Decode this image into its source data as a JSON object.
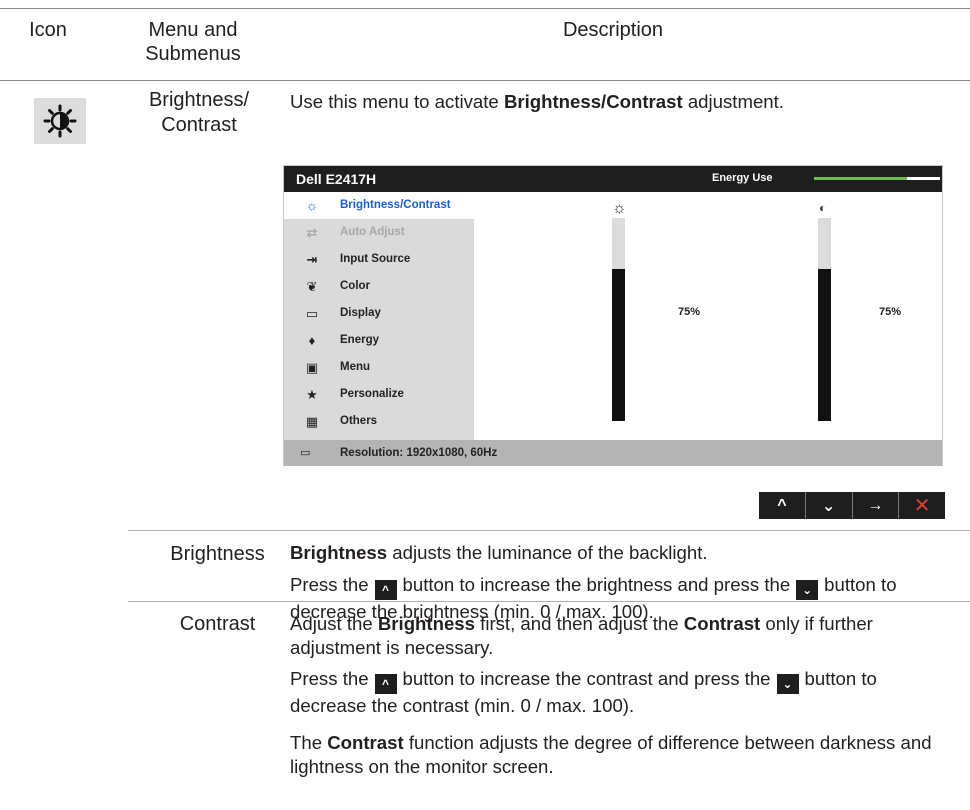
{
  "header": {
    "icon_col": "Icon",
    "menu_col_line1": "Menu and",
    "menu_col_line2": "Submenus",
    "desc_col": "Description"
  },
  "row_brightness_contrast": {
    "icon": "brightness-contrast-icon",
    "label_line1": "Brightness/",
    "label_line2": "Contrast",
    "desc_prefix": "Use this menu to activate ",
    "desc_bold": "Brightness/Contrast",
    "desc_suffix": " adjustment."
  },
  "osd": {
    "title": "Dell E2417H",
    "energy_label": "Energy Use",
    "energy_level": 0.74,
    "menu_items": [
      {
        "icon": "brightness-icon",
        "glyph": "☼",
        "label": "Brightness/Contrast",
        "state": "active"
      },
      {
        "icon": "auto-adjust-icon",
        "glyph": "⇄",
        "label": "Auto Adjust",
        "state": "dim"
      },
      {
        "icon": "input-source-icon",
        "glyph": "⇥",
        "label": "Input Source",
        "state": "normal"
      },
      {
        "icon": "color-icon",
        "glyph": "❦",
        "label": "Color",
        "state": "normal"
      },
      {
        "icon": "display-icon",
        "glyph": "▭",
        "label": "Display",
        "state": "normal"
      },
      {
        "icon": "energy-icon",
        "glyph": "♦",
        "label": "Energy",
        "state": "normal"
      },
      {
        "icon": "menu-icon",
        "glyph": "▣",
        "label": "Menu",
        "state": "normal"
      },
      {
        "icon": "personalize-icon",
        "glyph": "★",
        "label": "Personalize",
        "state": "normal"
      },
      {
        "icon": "others-icon",
        "glyph": "▦",
        "label": "Others",
        "state": "normal"
      }
    ],
    "brightness": {
      "icon": "sun-icon",
      "glyph": "☼",
      "value": 75,
      "value_label": "75%"
    },
    "contrast": {
      "icon": "contrast-icon",
      "glyph": "◐",
      "value": 75,
      "value_label": "75%"
    },
    "status_icon": "resolution-icon",
    "status_text": "Resolution: 1920x1080, 60Hz"
  },
  "nav_buttons": [
    {
      "icon": "chevron-up-icon",
      "glyph": "^"
    },
    {
      "icon": "chevron-down-icon",
      "glyph": "⌄"
    },
    {
      "icon": "arrow-right-icon",
      "glyph": "→"
    },
    {
      "icon": "close-icon",
      "glyph": "✕"
    }
  ],
  "row_brightness": {
    "label": "Brightness",
    "p1_bold": "Brightness",
    "p1_rest": " adjusts the luminance of the backlight.",
    "p2_a": "Press the",
    "p2_b": "button to increase the brightness and press the",
    "p2_c": "button to decrease the brightness (min. 0 / max. 100)."
  },
  "row_contrast": {
    "label": "Contrast",
    "p1_a": "Adjust the ",
    "p1_b": "Brightness",
    "p1_c": " first, and then adjust the ",
    "p1_d": "Contrast",
    "p1_e": " only if further adjustment is necessary.",
    "p2_a": "Press the",
    "p2_b": "button to increase the contrast and press the",
    "p2_c": "button to decrease the contrast (min. 0 / max. 100).",
    "p3_a": "The ",
    "p3_b": "Contrast",
    "p3_c": " function adjusts the degree of difference between darkness and lightness on the monitor screen."
  },
  "colors": {
    "accent_blue": "#1a5fd0",
    "energy_green": "#6cc04a",
    "close_red": "#e04030"
  }
}
